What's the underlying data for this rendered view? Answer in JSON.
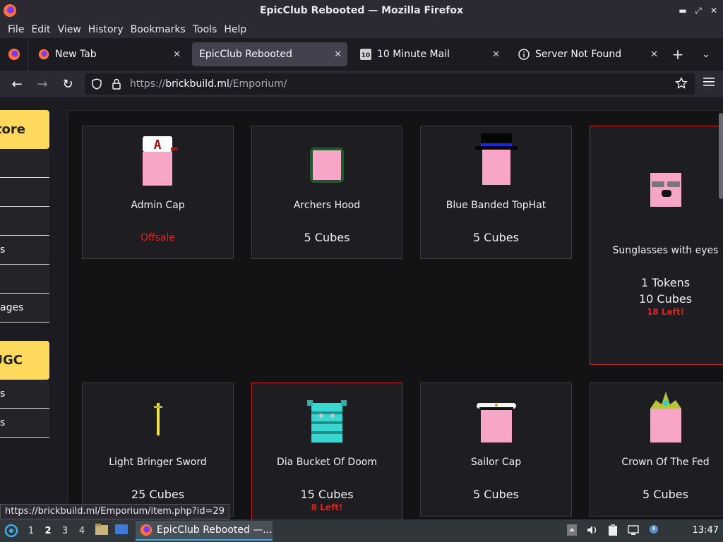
{
  "window": {
    "title": "EpicClub Rebooted — Mozilla Firefox"
  },
  "menu": [
    "File",
    "Edit",
    "View",
    "History",
    "Bookmarks",
    "Tools",
    "Help"
  ],
  "tabs": [
    {
      "label": "New Tab",
      "icon": "firefox-icon"
    },
    {
      "label": "EpicClub Rebooted",
      "icon": "none"
    },
    {
      "label": "10 Minute Mail",
      "icon": "10-icon"
    },
    {
      "label": "Server Not Found",
      "icon": "info-icon"
    }
  ],
  "tab_close": "✕",
  "address": {
    "prefix": "https://",
    "domain": "brickbuild.ml",
    "path": "/Emporium/"
  },
  "sidebar": {
    "store_heading": "tore",
    "store_items": [
      "",
      "",
      "",
      "s",
      "",
      "ages"
    ],
    "ugc_heading": "UGC",
    "ugc_items": [
      "s",
      "s"
    ]
  },
  "items": [
    {
      "name": "Admin Cap",
      "price": "",
      "status": "Offsale"
    },
    {
      "name": "Archers Hood",
      "price": "5 Cubes"
    },
    {
      "name": "Blue Banded TopHat",
      "price": "5 Cubes"
    },
    {
      "name": "Sunglasses with eyes",
      "price": "1 Tokens",
      "price2": "10 Cubes",
      "left": "18 Left!"
    },
    {
      "name": "Light Bringer Sword",
      "price": "25 Cubes"
    },
    {
      "name": "Dia Bucket Of Doom",
      "price": "15 Cubes",
      "left": "8 Left!"
    },
    {
      "name": "Sailor Cap",
      "price": "5 Cubes"
    },
    {
      "name": "Crown Of The Fed",
      "price": "5 Cubes"
    }
  ],
  "status_link": "https://brickbuild.ml/Emporium/item.php?id=29",
  "taskbar": {
    "workspaces": [
      "1",
      "2",
      "3",
      "4"
    ],
    "task_label": "EpicClub Rebooted —...",
    "clock": "13:47"
  },
  "colors": {
    "store_heading_bg": "#ffd95c",
    "featured_border": "#c62020",
    "offsale": "#e02020"
  }
}
